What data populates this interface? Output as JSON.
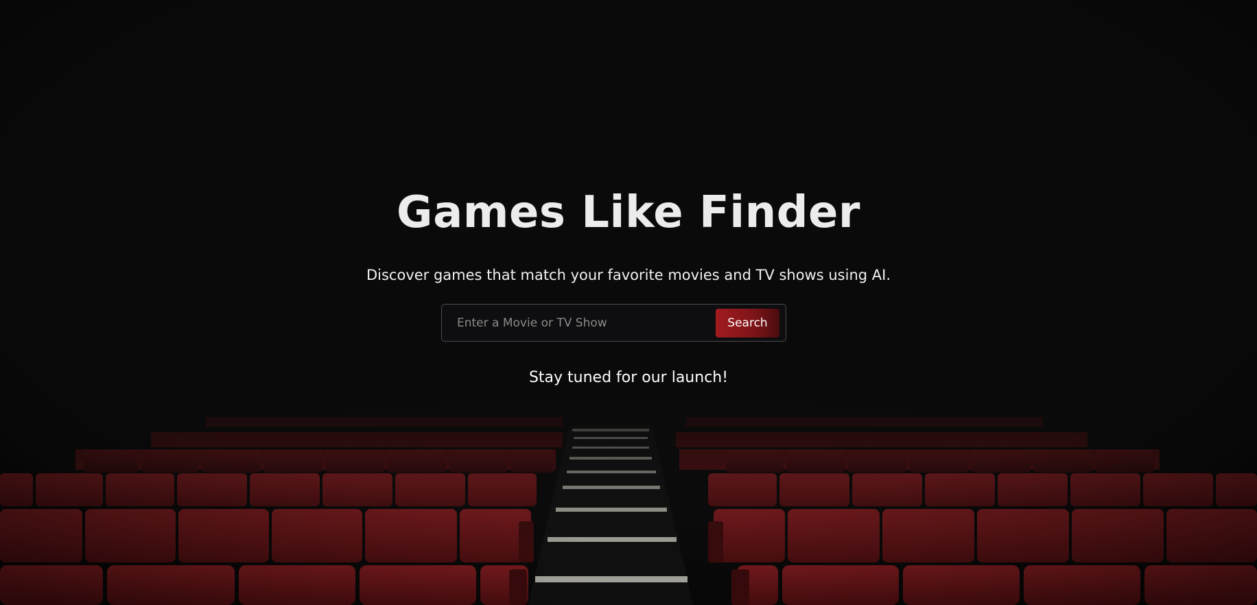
{
  "hero": {
    "title": "Games Like Finder",
    "subtitle": "Discover games that match your favorite movies and TV shows using AI.",
    "launch_message": "Stay tuned for our launch!"
  },
  "search": {
    "placeholder": "Enter a Movie or TV Show",
    "value": "",
    "button_label": "Search"
  },
  "colors": {
    "background": "#0a0a0a",
    "accent": "#a11b1f",
    "seat_red": "#8a1a1c"
  },
  "background_image": {
    "icon": "theater-seats-image"
  }
}
